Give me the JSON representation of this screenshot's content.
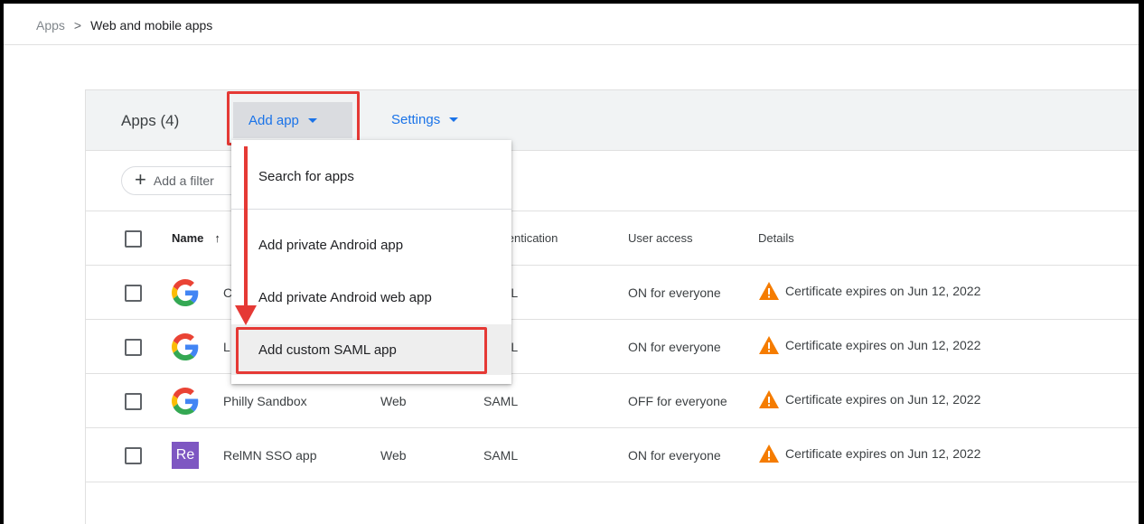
{
  "breadcrumb": {
    "root": "Apps",
    "separator": ">",
    "current": "Web and mobile apps"
  },
  "header": {
    "apps_count": "Apps (4)",
    "add_app_label": "Add app",
    "settings_label": "Settings"
  },
  "filter": {
    "label": "Add a filter",
    "icon": "plus-icon"
  },
  "table": {
    "columns": {
      "name": "Name",
      "sort_icon": "↑",
      "authentication": "Authentication",
      "user_access": "User access",
      "details": "Details"
    },
    "rows": [
      {
        "logo": "google-logo",
        "name": "C",
        "platform": "",
        "authentication": "SAML",
        "user_access": "ON for everyone",
        "details": "Certificate expires on Jun 12, 2022"
      },
      {
        "logo": "google-logo",
        "name": "L",
        "platform": "",
        "authentication": "SAML",
        "user_access": "ON for everyone",
        "details": "Certificate expires on Jun 12, 2022"
      },
      {
        "logo": "google-logo",
        "name": "Philly Sandbox",
        "platform": "Web",
        "authentication": "SAML",
        "user_access": "OFF for everyone",
        "details": "Certificate expires on Jun 12, 2022"
      },
      {
        "logo": "re-logo",
        "logo_text": "Re",
        "name": "RelMN SSO app",
        "platform": "Web",
        "authentication": "SAML",
        "user_access": "ON for everyone",
        "details": "Certificate expires on Jun 12, 2022"
      }
    ]
  },
  "menu": {
    "items": [
      "Search for apps",
      "Add private Android app",
      "Add private Android web app",
      "Add custom SAML app"
    ]
  },
  "colors": {
    "accent": "#1a73e8",
    "highlight": "#e53935",
    "warning": "#f57c00",
    "re_logo": "#7e57c2"
  }
}
